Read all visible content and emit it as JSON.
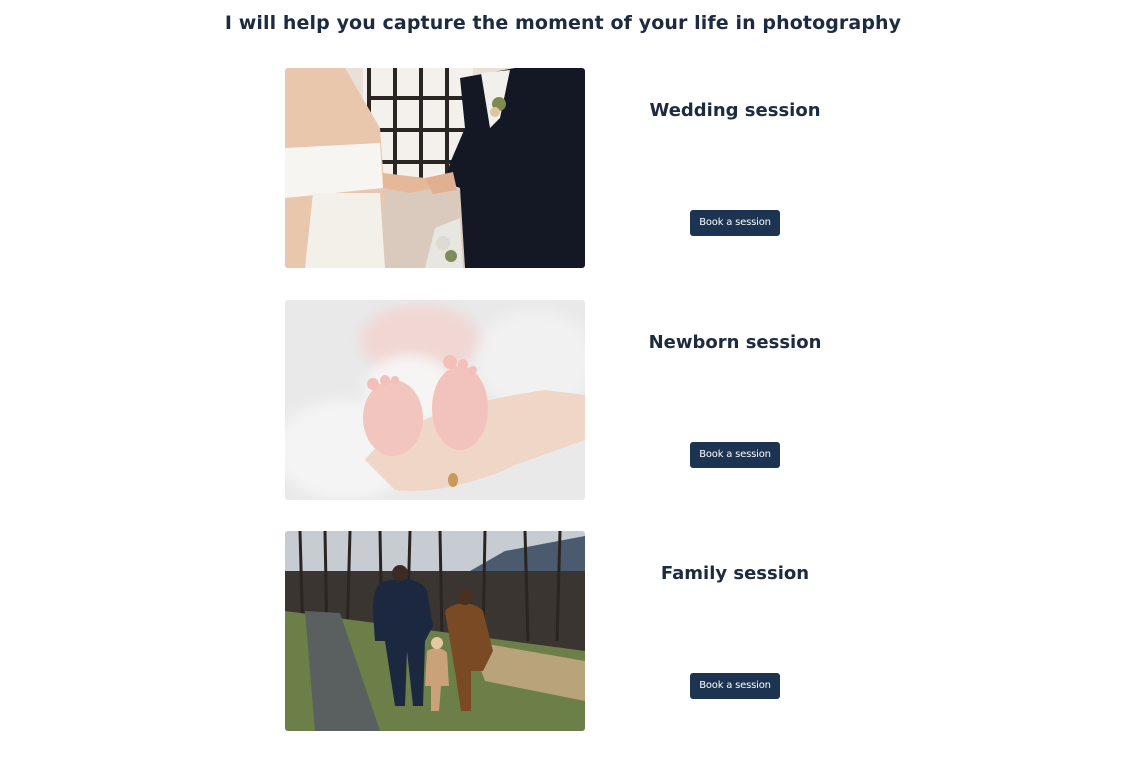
{
  "page": {
    "title": "I will help you capture the moment of your life in photography"
  },
  "sessions": [
    {
      "title": "Wedding session",
      "button_label": "Book a session",
      "image": "wedding-photo"
    },
    {
      "title": "Newborn session",
      "button_label": "Book a session",
      "image": "newborn-photo"
    },
    {
      "title": "Family session",
      "button_label": "Book a session",
      "image": "family-photo"
    }
  ],
  "colors": {
    "heading": "#1c2b3f",
    "button_bg": "#1c3352",
    "button_text": "#ffffff",
    "background": "#ffffff"
  }
}
